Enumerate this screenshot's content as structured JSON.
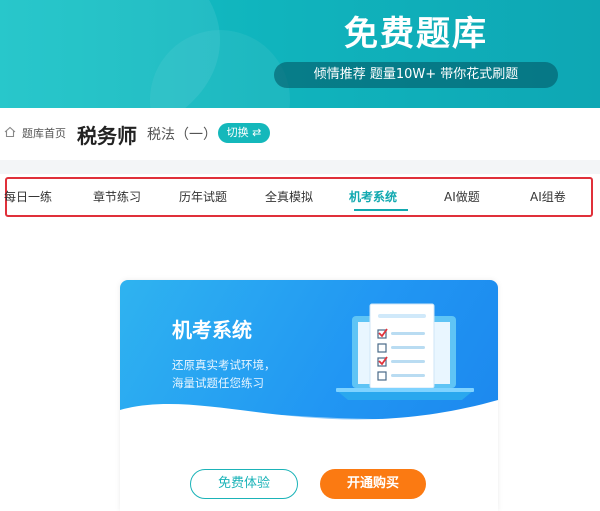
{
  "banner": {
    "title": "免费题库",
    "slogan": "倾情推荐 题量10W+ 带你花式刷题"
  },
  "breadcrumb": {
    "home_label": "题库首页",
    "exam_title": "税务师",
    "subject": "税法（一）",
    "switch_label": "切换 ⇄"
  },
  "tabs": [
    {
      "label": "每日一练"
    },
    {
      "label": "章节练习"
    },
    {
      "label": "历年试题"
    },
    {
      "label": "全真模拟"
    },
    {
      "label": "机考系统",
      "active": true
    },
    {
      "label": "AI做题"
    },
    {
      "label": "AI组卷"
    }
  ],
  "card": {
    "title": "机考系统",
    "desc_line1": "还原真实考试环境，",
    "desc_line2": "海量试题任您练习",
    "free_button": "免费体验",
    "buy_button": "开通购买"
  },
  "colors": {
    "accent": "#12a9b0",
    "buy": "#fb7a12",
    "highlight_border": "#e0303a"
  }
}
